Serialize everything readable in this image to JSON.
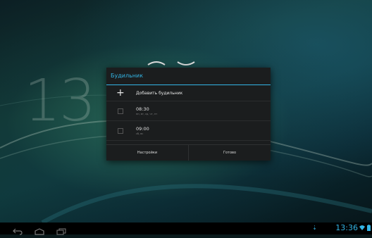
{
  "lockscreen": {
    "clock_partial": "13"
  },
  "dialog": {
    "title": "Будильник",
    "add_label": "Добавить будильник",
    "alarms": [
      {
        "time": "08:30",
        "days": "пн, вт, ср, чт, пт"
      },
      {
        "time": "09:00",
        "days": "сб, вс"
      }
    ],
    "settings_label": "Настройки",
    "done_label": "Готово"
  },
  "status_bar": {
    "time": "13:36",
    "accent_color": "#33b5e5"
  },
  "icons": {
    "back": "back-icon",
    "home": "home-icon",
    "recents": "recents-icon",
    "sync": "sync-icon",
    "wifi": "wifi-icon",
    "battery": "battery-icon"
  }
}
